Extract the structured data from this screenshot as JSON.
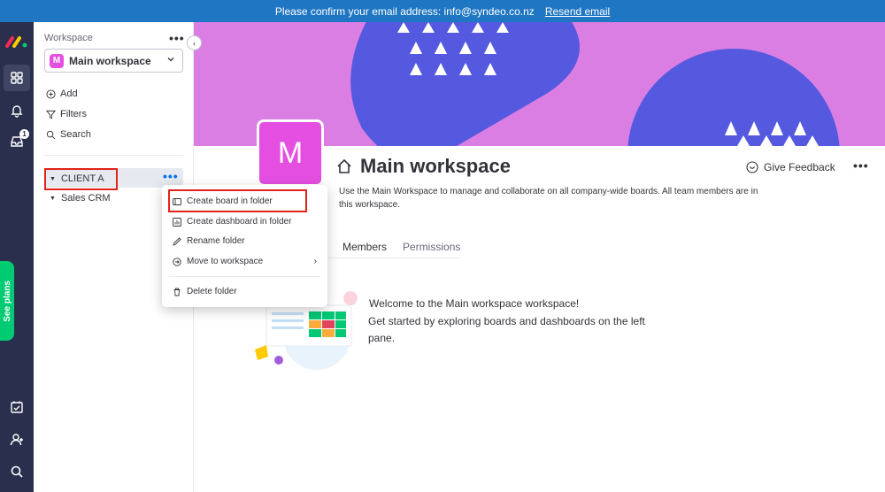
{
  "banner": {
    "message": "Please confirm your email address: info@syndeo.co.nz",
    "resend_link": "Resend email"
  },
  "rail": {
    "notification_badge": "1",
    "see_plans": "See plans",
    "icons": [
      "workspaces-icon",
      "bell-icon",
      "inbox-icon",
      "my-work-icon",
      "invite-icon",
      "search-icon"
    ]
  },
  "sidebar": {
    "label": "Workspace",
    "workspace": {
      "avatar_letter": "M",
      "name": "Main workspace"
    },
    "actions": {
      "add": "Add",
      "filters": "Filters",
      "search": "Search"
    },
    "folders": [
      {
        "name": "CLIENT A"
      },
      {
        "name": "Sales CRM"
      }
    ]
  },
  "menu": {
    "items": {
      "create_board": "Create board in folder",
      "create_dashboard": "Create dashboard in folder",
      "rename": "Rename folder",
      "move": "Move to workspace",
      "delete": "Delete folder"
    }
  },
  "main": {
    "avatar_letter": "M",
    "title": "Main workspace",
    "description": "Use the Main Workspace to manage and collaborate on all company-wide boards. All team members are in this workspace.",
    "feedback": "Give Feedback",
    "tabs": [
      "Members",
      "Permissions"
    ],
    "welcome": "Welcome to the Main workspace workspace!",
    "subtext": "Get started by exploring boards and dashboards on the left pane."
  },
  "colors": {
    "banner": "#1f76c2",
    "rail": "#292f4c",
    "cover": "#da7ee3",
    "cover_shape": "#5559df",
    "accent": "#e44fe1",
    "see_plans": "#00ca72",
    "highlight": "#e2231a"
  }
}
